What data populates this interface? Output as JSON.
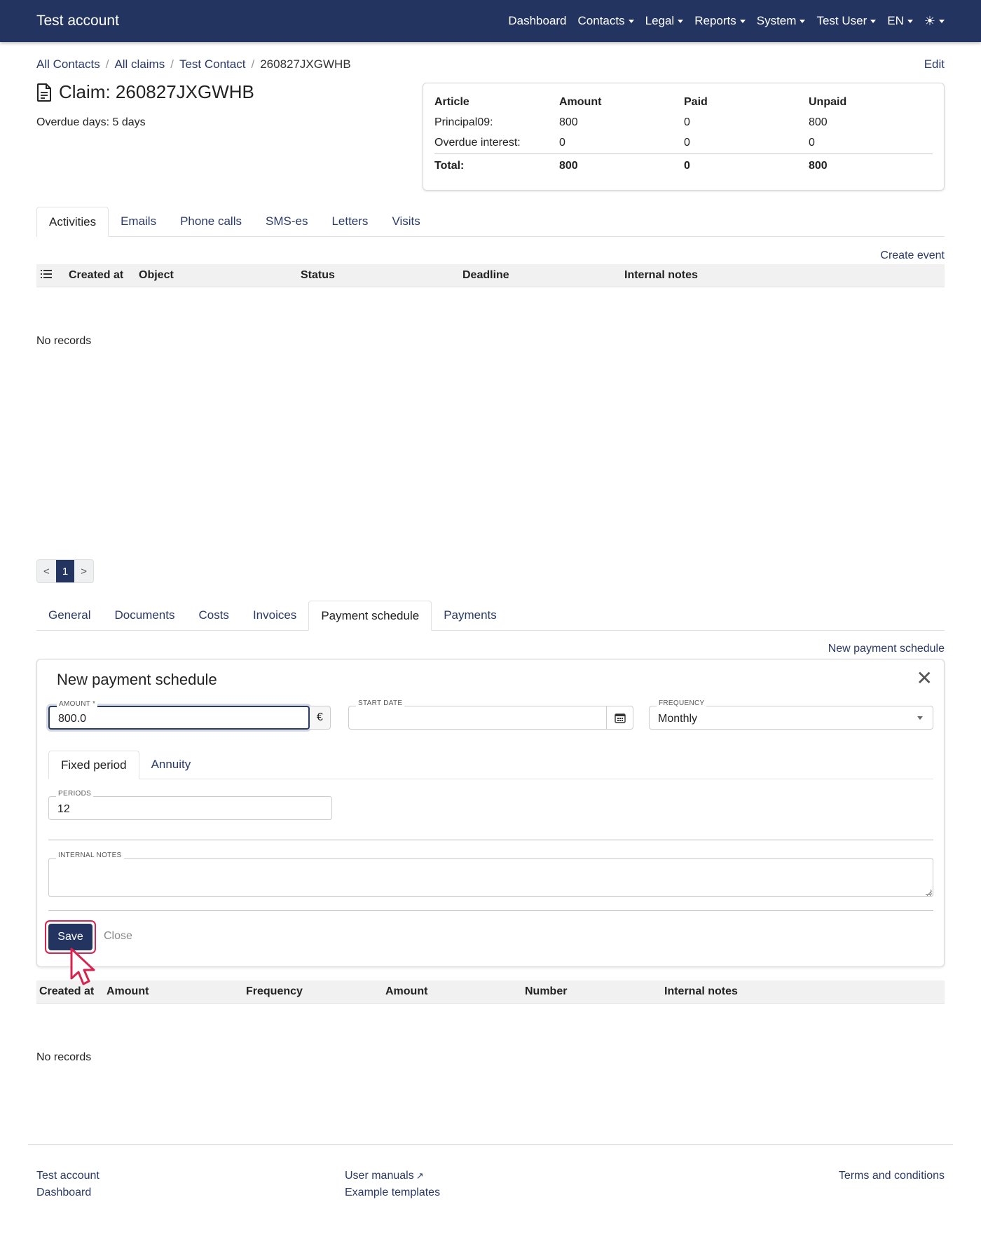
{
  "navbar": {
    "brand": "Test account",
    "items": [
      {
        "label": "Dashboard",
        "dropdown": false
      },
      {
        "label": "Contacts",
        "dropdown": true
      },
      {
        "label": "Legal",
        "dropdown": true
      },
      {
        "label": "Reports",
        "dropdown": true
      },
      {
        "label": "System",
        "dropdown": true
      },
      {
        "label": "Test User",
        "dropdown": true
      },
      {
        "label": "EN",
        "dropdown": true
      }
    ],
    "theme_icon": "sun-icon"
  },
  "breadcrumb": {
    "items": [
      "All Contacts",
      "All claims",
      "Test Contact"
    ],
    "current": "260827JXGWHB",
    "edit": "Edit"
  },
  "claim": {
    "title": "Claim: 260827JXGWHB",
    "overdue": "Overdue days: 5 days"
  },
  "summary": {
    "headers": [
      "Article",
      "Amount",
      "Paid",
      "Unpaid"
    ],
    "rows": [
      [
        "Principal09:",
        "800",
        "0",
        "800"
      ],
      [
        "Overdue interest:",
        "0",
        "0",
        "0"
      ]
    ],
    "total": [
      "Total:",
      "800",
      "0",
      "800"
    ]
  },
  "activity_tabs": {
    "items": [
      "Activities",
      "Emails",
      "Phone calls",
      "SMS-es",
      "Letters",
      "Visits"
    ],
    "active": 0
  },
  "activities": {
    "create_event": "Create event",
    "columns": [
      "Created at",
      "Object",
      "Status",
      "Deadline",
      "Internal notes"
    ],
    "empty": "No records"
  },
  "pagination": {
    "prev": "<",
    "current": "1",
    "next": ">"
  },
  "claim_tabs": {
    "items": [
      "General",
      "Documents",
      "Costs",
      "Invoices",
      "Payment schedule",
      "Payments"
    ],
    "active": 4
  },
  "payment_schedule": {
    "new_link": "New payment schedule",
    "form": {
      "title": "New payment schedule",
      "amount_label": "AMOUNT *",
      "amount_value": "800.0",
      "currency": "€",
      "start_date_label": "START DATE",
      "start_date_value": "",
      "frequency_label": "FREQUENCY",
      "frequency_value": "Monthly",
      "subtabs": [
        "Fixed period",
        "Annuity"
      ],
      "subtab_active": 0,
      "periods_label": "PERIODS",
      "periods_value": "12",
      "notes_label": "INTERNAL NOTES",
      "notes_value": "",
      "save": "Save",
      "close": "Close"
    },
    "columns": [
      "Created at",
      "Amount",
      "Frequency",
      "Amount",
      "Number",
      "Internal notes"
    ],
    "empty": "No records"
  },
  "footer": {
    "col1": [
      "Test account",
      "Dashboard"
    ],
    "col2": [
      "User manuals",
      "Example templates"
    ],
    "col3": [
      "Terms and conditions"
    ]
  },
  "colors": {
    "navbar": "#233461",
    "link": "#2a3a66",
    "highlight": "#d6244f"
  }
}
